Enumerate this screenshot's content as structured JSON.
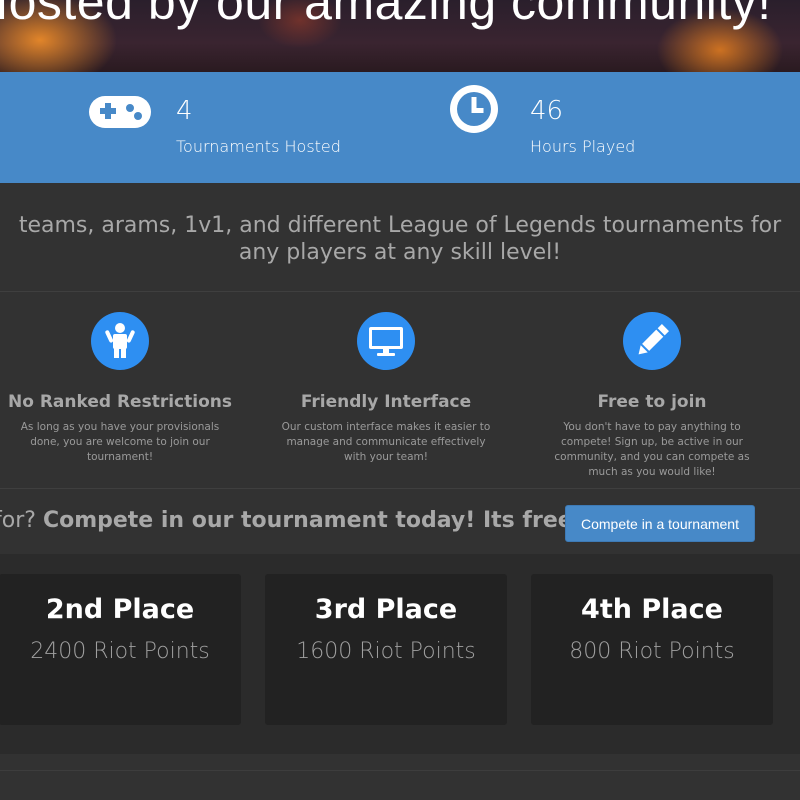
{
  "hero": {
    "title": "Hosted by our amazing community!"
  },
  "stats": [
    {
      "icon": "gamepad-icon",
      "value": "4",
      "label": "Tournaments Hosted"
    },
    {
      "icon": "clock-icon",
      "value": "46",
      "label": "Hours Played"
    }
  ],
  "description": {
    "line1": "teams, arams, 1v1, and different League of Legends tournaments for",
    "line2": "any players at any skill level!"
  },
  "features": [
    {
      "icon": "person-icon",
      "title": "No Ranked Restrictions",
      "text": "As long as you have your provisionals done, you are welcome to join our tournament!"
    },
    {
      "icon": "monitor-icon",
      "title": "Friendly Interface",
      "text": "Our custom interface makes it easier to manage and communicate effectively with your team!"
    },
    {
      "icon": "pencil-icon",
      "title": "Free to join",
      "text": "You don't have to pay anything to compete! Sign up, be active in our community, and you can compete as much as you would like!"
    }
  ],
  "cta": {
    "lead": "for?",
    "bold": "Compete in our tournament today! Its free!",
    "button_label": "Compete in a tournament"
  },
  "prizes": [
    {
      "place": "2nd Place",
      "points": "2400 Riot Points"
    },
    {
      "place": "3rd Place",
      "points": "1600 Riot Points"
    },
    {
      "place": "4th Place",
      "points": "800 Riot Points"
    }
  ],
  "colors": {
    "accent": "#4789c8",
    "icon_circle": "#2e8ff2",
    "background": "#323232",
    "card": "#222222"
  }
}
